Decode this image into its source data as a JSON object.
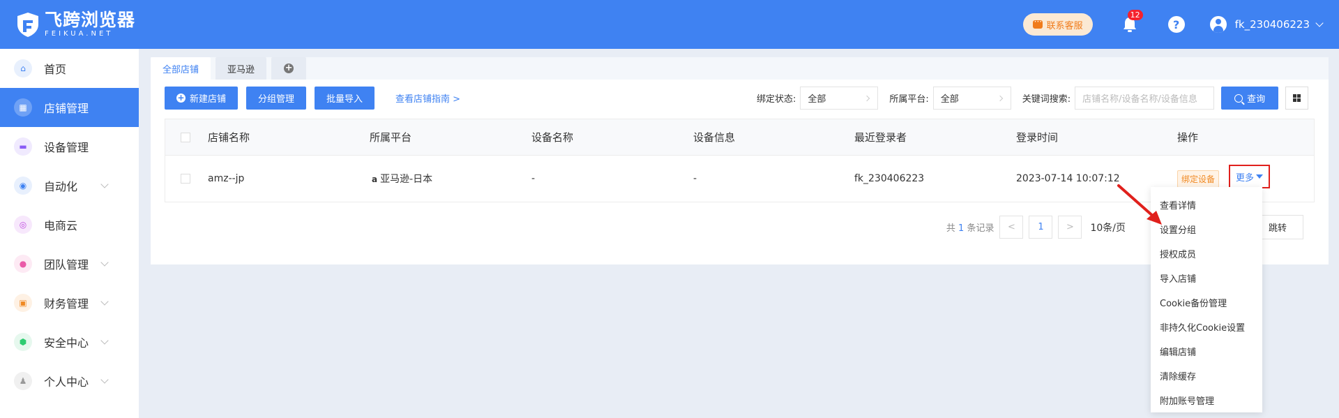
{
  "header": {
    "logo_main": "飞跨浏览器",
    "logo_sub": "FEIKUA.NET",
    "support_label": "联系客服",
    "notification_count": "12",
    "help_glyph": "?",
    "username": "fk_230406223",
    "brand_color": "#3f82f2"
  },
  "sidebar": {
    "items": [
      {
        "label": "首页",
        "icon": "home-icon",
        "color": "#3f82f2"
      },
      {
        "label": "店铺管理",
        "icon": "store-icon",
        "color": "#ffffff"
      },
      {
        "label": "设备管理",
        "icon": "device-icon",
        "color": "#8a5cf5"
      },
      {
        "label": "自动化",
        "icon": "robot-icon",
        "color": "#3f82f2"
      },
      {
        "label": "电商云",
        "icon": "cloud-icon",
        "color": "#c04be0"
      },
      {
        "label": "团队管理",
        "icon": "team-icon",
        "color": "#ea5aa8"
      },
      {
        "label": "财务管理",
        "icon": "wallet-icon",
        "color": "#f08a24"
      },
      {
        "label": "安全中心",
        "icon": "shield-icon",
        "color": "#2ecc71"
      },
      {
        "label": "个人中心",
        "icon": "person-icon",
        "color": "#999999"
      }
    ]
  },
  "tabs": [
    {
      "label": "全部店铺"
    },
    {
      "label": "亚马逊"
    }
  ],
  "toolbar": {
    "new_store": "新建店铺",
    "group_manage": "分组管理",
    "batch_import": "批量导入",
    "guide_link": "查看店铺指南 >"
  },
  "filters": {
    "bind_status_label": "绑定状态:",
    "bind_status_value": "全部",
    "platform_label": "所属平台:",
    "platform_value": "全部",
    "keyword_label": "关键词搜索:",
    "keyword_placeholder": "店铺名称/设备名称/设备信息",
    "query_label": "查询"
  },
  "table": {
    "columns": [
      "店铺名称",
      "所属平台",
      "设备名称",
      "设备信息",
      "最近登录者",
      "登录时间",
      "操作"
    ],
    "rows": [
      {
        "store_name": "amz--jp",
        "platform_icon": "a",
        "platform": "亚马逊-日本",
        "device_name": "-",
        "device_info": "-",
        "last_login_user": "fk_230406223",
        "login_time": "2023-07-14 10:07:12",
        "bind_action": "绑定设备",
        "more_action": "更多"
      }
    ]
  },
  "pagination": {
    "total_prefix": "共",
    "total_count": "1",
    "total_suffix": "条记录",
    "prev": "<",
    "current_page": "1",
    "next": ">",
    "page_size": "10条/页",
    "page_suffix": "页",
    "jump_label": "跳转"
  },
  "more_menu": {
    "items": [
      "查看详情",
      "设置分组",
      "授权成员",
      "导入店铺",
      "Cookie备份管理",
      "非持久化Cookie设置",
      "编辑店铺",
      "清除缓存",
      "附加账号管理"
    ]
  }
}
